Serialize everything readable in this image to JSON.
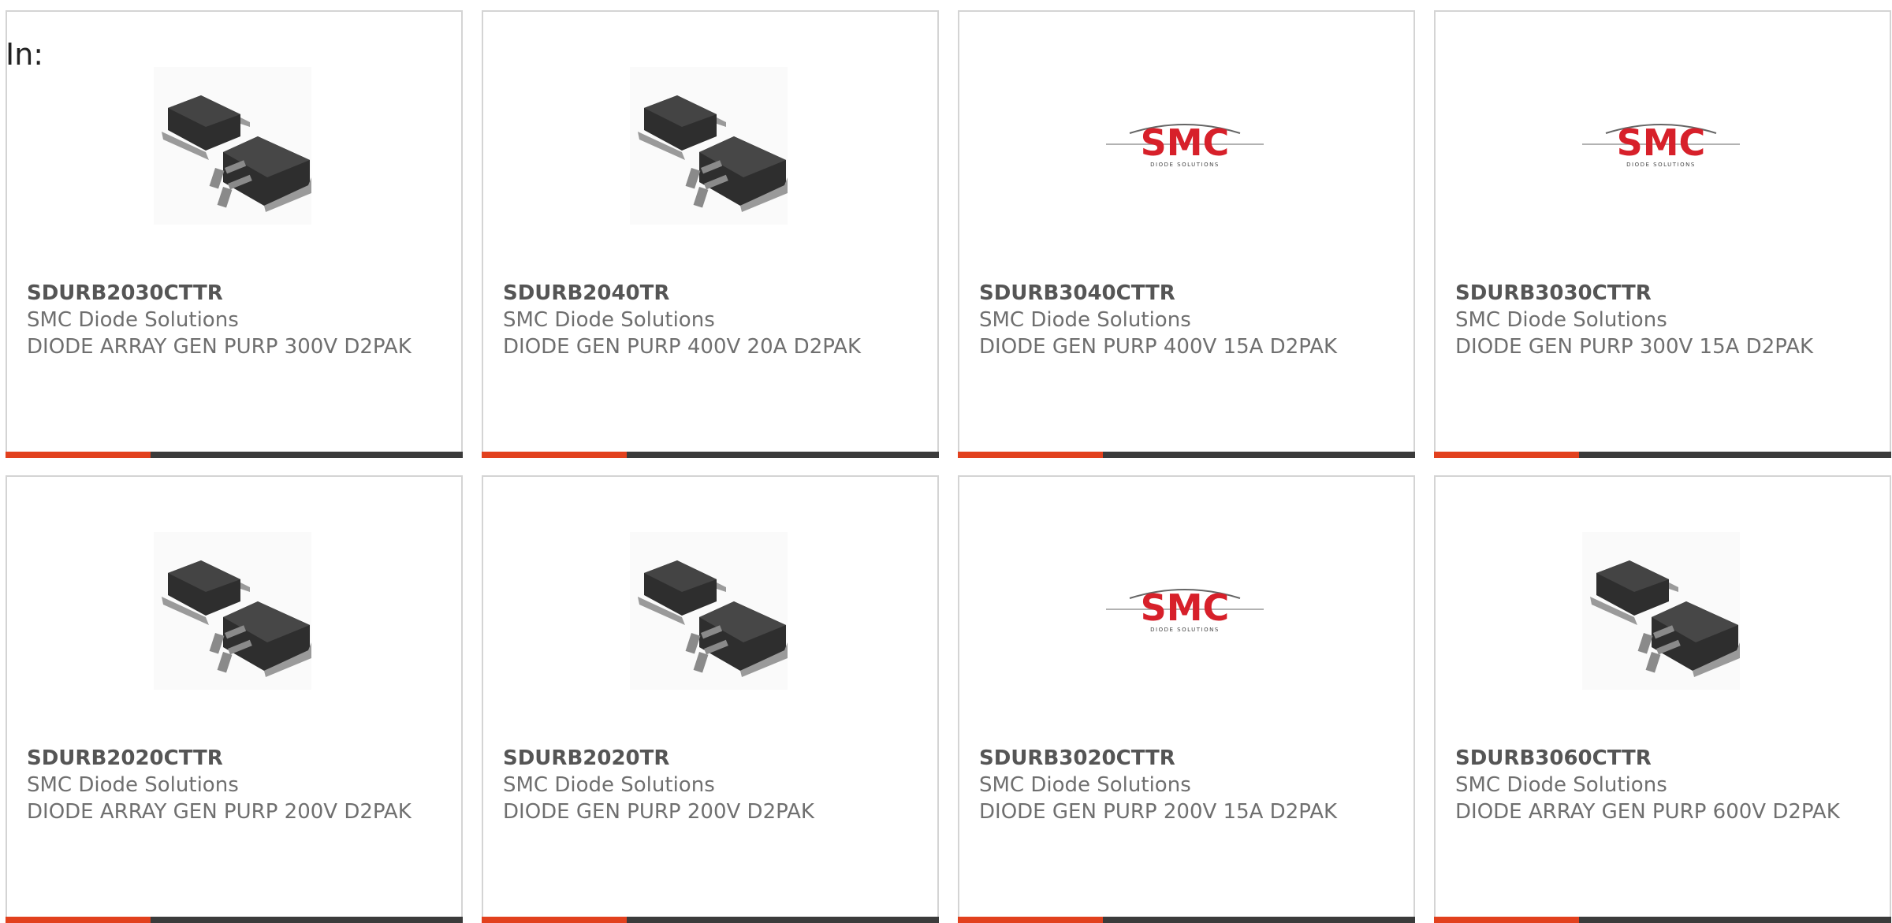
{
  "filter_label": "In:",
  "accent_color": "#e2411e",
  "bar_color": "#3b3b3b",
  "products": [
    {
      "part": "SDURB2030CTTR",
      "maker": "SMC Diode Solutions",
      "desc": "DIODE ARRAY GEN PURP 300V D2PAK",
      "image": "d2pak-package-icon"
    },
    {
      "part": "SDURB2040TR",
      "maker": "SMC Diode Solutions",
      "desc": "DIODE GEN PURP 400V 20A D2PAK",
      "image": "d2pak-package-icon"
    },
    {
      "part": "SDURB3040CTTR",
      "maker": "SMC Diode Solutions",
      "desc": "DIODE GEN PURP 400V 15A D2PAK",
      "image": "smc-logo",
      "logo_text": "SMC",
      "logo_sub": "DIODE SOLUTIONS"
    },
    {
      "part": "SDURB3030CTTR",
      "maker": "SMC Diode Solutions",
      "desc": "DIODE GEN PURP 300V 15A D2PAK",
      "image": "smc-logo",
      "logo_text": "SMC",
      "logo_sub": "DIODE SOLUTIONS"
    },
    {
      "part": "SDURB2020CTTR",
      "maker": "SMC Diode Solutions",
      "desc": "DIODE ARRAY GEN PURP 200V D2PAK",
      "image": "d2pak-package-icon"
    },
    {
      "part": "SDURB2020TR",
      "maker": "SMC Diode Solutions",
      "desc": "DIODE GEN PURP 200V D2PAK",
      "image": "d2pak-package-icon"
    },
    {
      "part": "SDURB3020CTTR",
      "maker": "SMC Diode Solutions",
      "desc": "DIODE GEN PURP 200V 15A D2PAK",
      "image": "smc-logo",
      "logo_text": "SMC",
      "logo_sub": "DIODE SOLUTIONS"
    },
    {
      "part": "SDURB3060CTTR",
      "maker": "SMC Diode Solutions",
      "desc": "DIODE ARRAY GEN PURP 600V D2PAK",
      "image": "d2pak-package-icon"
    }
  ]
}
